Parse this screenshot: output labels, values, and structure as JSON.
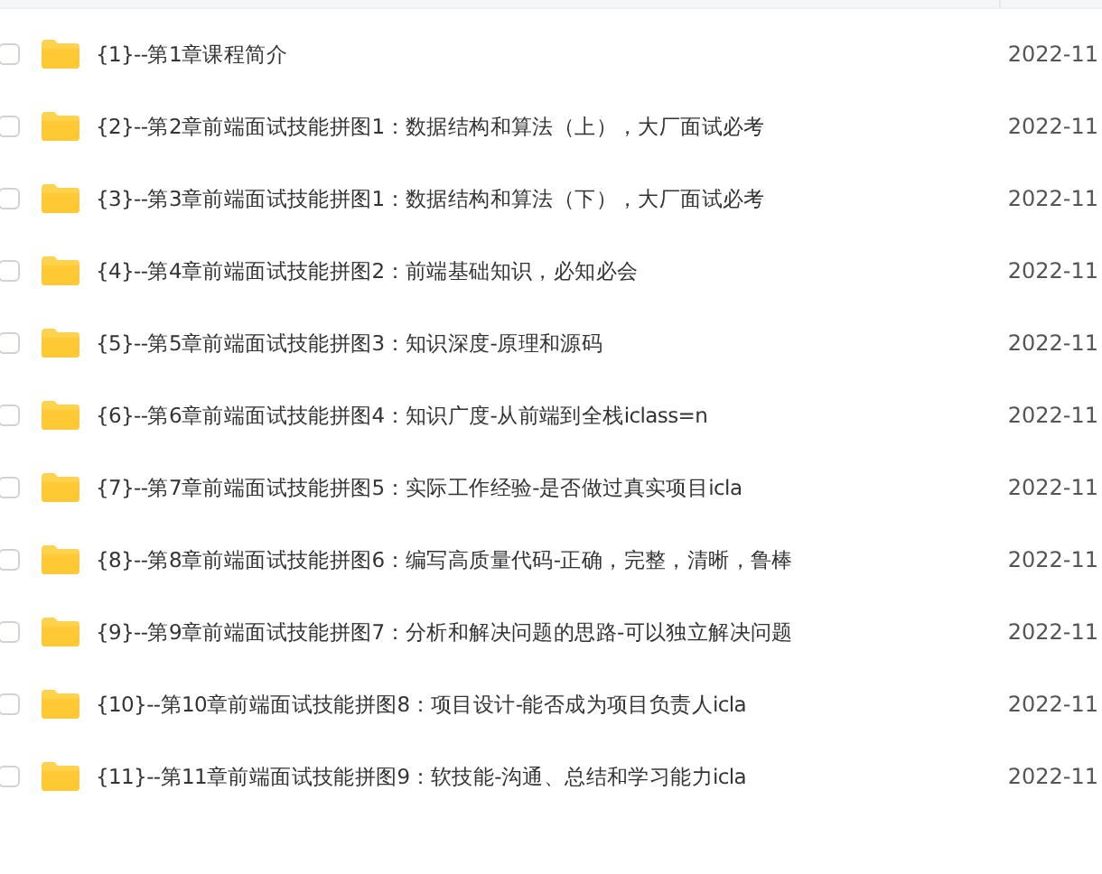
{
  "files": [
    {
      "name": "{1}--第1章课程简介",
      "date": "2022-11",
      "checked": false
    },
    {
      "name": "{2}--第2章前端面试技能拼图1：数据结构和算法（上），大厂面试必考",
      "date": "2022-11",
      "checked": false
    },
    {
      "name": "{3}--第3章前端面试技能拼图1：数据结构和算法（下），大厂面试必考",
      "date": "2022-11",
      "checked": false
    },
    {
      "name": "{4}--第4章前端面试技能拼图2：前端基础知识，必知必会",
      "date": "2022-11",
      "checked": false
    },
    {
      "name": "{5}--第5章前端面试技能拼图3：知识深度-原理和源码",
      "date": "2022-11",
      "checked": false
    },
    {
      "name": "{6}--第6章前端面试技能拼图4：知识广度-从前端到全栈iclass=n",
      "date": "2022-11",
      "checked": false
    },
    {
      "name": "{7}--第7章前端面试技能拼图5：实际工作经验-是否做过真实项目icla",
      "date": "2022-11",
      "checked": false
    },
    {
      "name": "{8}--第8章前端面试技能拼图6：编写高质量代码-正确，完整，清晰，鲁棒",
      "date": "2022-11",
      "checked": false
    },
    {
      "name": "{9}--第9章前端面试技能拼图7：分析和解决问题的思路-可以独立解决问题",
      "date": "2022-11",
      "checked": false
    },
    {
      "name": "{10}--第10章前端面试技能拼图8：项目设计-能否成为项目负责人icla",
      "date": "2022-11",
      "checked": false
    },
    {
      "name": "{11}--第11章前端面试技能拼图9：软技能-沟通、总结和学习能力icla",
      "date": "2022-11",
      "checked": false
    }
  ]
}
